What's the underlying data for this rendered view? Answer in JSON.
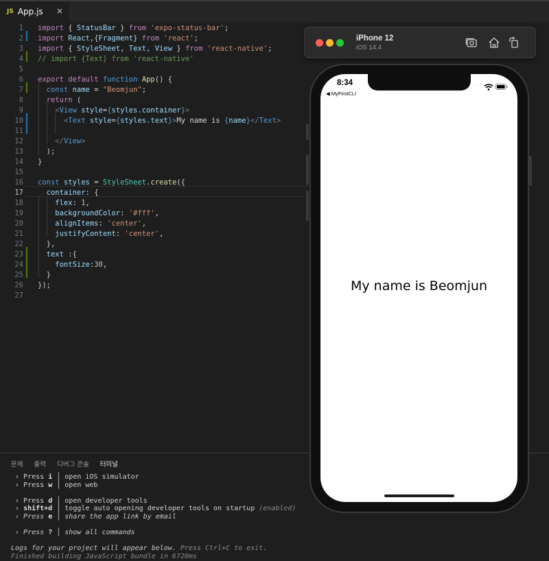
{
  "editor": {
    "tab": {
      "icon": "js-icon",
      "icon_label": "JS",
      "label": "App.js",
      "close": "×"
    },
    "lines": [
      [
        [
          "kw",
          "import"
        ],
        [
          "txt",
          " { "
        ],
        [
          "var",
          "StatusBar"
        ],
        [
          "txt",
          " } "
        ],
        [
          "kw",
          "from"
        ],
        [
          "str",
          " 'expo-status-bar'"
        ],
        [
          "txt",
          ";"
        ]
      ],
      [
        [
          "kw",
          "import"
        ],
        [
          "var",
          " React"
        ],
        [
          "txt",
          ",{"
        ],
        [
          "var",
          "Fragment"
        ],
        [
          "txt",
          "} "
        ],
        [
          "kw",
          "from"
        ],
        [
          "str",
          " 'react'"
        ],
        [
          "txt",
          ";"
        ]
      ],
      [
        [
          "kw",
          "import"
        ],
        [
          "txt",
          " { "
        ],
        [
          "var",
          "StyleSheet"
        ],
        [
          "txt",
          ", "
        ],
        [
          "var",
          "Text"
        ],
        [
          "txt",
          ", "
        ],
        [
          "var",
          "View"
        ],
        [
          "txt",
          " } "
        ],
        [
          "kw",
          "from"
        ],
        [
          "str",
          " 'react-native'"
        ],
        [
          "txt",
          ";"
        ]
      ],
      [
        [
          "cmt",
          "// import {Text} from 'react-native'"
        ]
      ],
      [],
      [
        [
          "kw",
          "export"
        ],
        [
          "kw",
          " default"
        ],
        [
          "b",
          " function"
        ],
        [
          "fn",
          " App"
        ],
        [
          "txt",
          "() {"
        ]
      ],
      [
        [
          "txt",
          "  "
        ],
        [
          "b",
          "const"
        ],
        [
          "var",
          " name"
        ],
        [
          "txt",
          " = "
        ],
        [
          "str",
          "\"Beomjun\""
        ],
        [
          "txt",
          ";"
        ]
      ],
      [
        [
          "txt",
          "  "
        ],
        [
          "kw",
          "return"
        ],
        [
          "txt",
          " ("
        ]
      ],
      [
        [
          "txt",
          "    "
        ],
        [
          "gray",
          "<"
        ],
        [
          "tag",
          "View"
        ],
        [
          "attr",
          " style"
        ],
        [
          "txt",
          "="
        ],
        [
          "b",
          "{"
        ],
        [
          "var",
          "styles"
        ],
        [
          "txt",
          "."
        ],
        [
          "var",
          "container"
        ],
        [
          "b",
          "}"
        ],
        [
          "gray",
          ">"
        ]
      ],
      [
        [
          "txt",
          "      "
        ],
        [
          "gray",
          "<"
        ],
        [
          "tag",
          "Text"
        ],
        [
          "attr",
          " style"
        ],
        [
          "txt",
          "="
        ],
        [
          "b",
          "{"
        ],
        [
          "var",
          "styles"
        ],
        [
          "txt",
          "."
        ],
        [
          "var",
          "text"
        ],
        [
          "b",
          "}"
        ],
        [
          "gray",
          ">"
        ],
        [
          "txt",
          "My name is "
        ],
        [
          "b",
          "{"
        ],
        [
          "var",
          "name"
        ],
        [
          "b",
          "}"
        ],
        [
          "gray",
          "</"
        ],
        [
          "tag",
          "Text"
        ],
        [
          "gray",
          ">"
        ]
      ],
      [],
      [
        [
          "txt",
          "    "
        ],
        [
          "gray",
          "</"
        ],
        [
          "tag",
          "View"
        ],
        [
          "gray",
          ">"
        ]
      ],
      [
        [
          "txt",
          "  );"
        ]
      ],
      [
        [
          "txt",
          "}"
        ]
      ],
      [],
      [
        [
          "b",
          "const"
        ],
        [
          "var",
          " styles"
        ],
        [
          "txt",
          " = "
        ],
        [
          "cls",
          "StyleSheet"
        ],
        [
          "txt",
          "."
        ],
        [
          "fn",
          "create"
        ],
        [
          "txt",
          "({"
        ]
      ],
      [
        [
          "var",
          "  container"
        ],
        [
          "txt",
          ": {"
        ]
      ],
      [
        [
          "var",
          "    flex"
        ],
        [
          "txt",
          ": "
        ],
        [
          "num",
          "1"
        ],
        [
          "txt",
          ","
        ]
      ],
      [
        [
          "var",
          "    backgroundColor"
        ],
        [
          "txt",
          ": "
        ],
        [
          "str",
          "'#fff'"
        ],
        [
          "txt",
          ","
        ]
      ],
      [
        [
          "var",
          "    alignItems"
        ],
        [
          "txt",
          ": "
        ],
        [
          "str",
          "'center'"
        ],
        [
          "txt",
          ","
        ]
      ],
      [
        [
          "var",
          "    justifyContent"
        ],
        [
          "txt",
          ": "
        ],
        [
          "str",
          "'center'"
        ],
        [
          "txt",
          ","
        ]
      ],
      [
        [
          "txt",
          "  },"
        ]
      ],
      [
        [
          "var",
          "  text"
        ],
        [
          "txt",
          " :{"
        ]
      ],
      [
        [
          "var",
          "    fontSize"
        ],
        [
          "txt",
          ":"
        ],
        [
          "num",
          "30"
        ],
        [
          "txt",
          ","
        ]
      ],
      [
        [
          "txt",
          "  }"
        ]
      ],
      [
        [
          "txt",
          "});"
        ]
      ],
      []
    ],
    "active_line": 17
  },
  "panel": {
    "tabs": [
      "문제",
      "출력",
      "디버그 콘솔",
      "터미널"
    ],
    "active_tab": 3,
    "terminal": [
      [
        [
          "txt",
          " › Press "
        ],
        [
          "k",
          "i"
        ],
        [
          "txt",
          " │ open iOS simulator"
        ]
      ],
      [
        [
          "txt",
          " › Press "
        ],
        [
          "k",
          "w"
        ],
        [
          "txt",
          " │ open web"
        ]
      ],
      [],
      [
        [
          "txt",
          " › Press "
        ],
        [
          "k",
          "d"
        ],
        [
          "txt",
          " │ open developer tools"
        ]
      ],
      [
        [
          "txt",
          " › "
        ],
        [
          "k",
          "shift+d"
        ],
        [
          "txt",
          " │ toggle auto opening developer tools on startup "
        ],
        [
          "dim",
          "(enabled)"
        ]
      ],
      [
        [
          "it",
          " › Press "
        ],
        [
          "k",
          "e"
        ],
        [
          "it",
          " │ share the app link by email"
        ]
      ],
      [],
      [
        [
          "it",
          " › Press "
        ],
        [
          "k",
          "?"
        ],
        [
          "it",
          " │ show all commands"
        ]
      ],
      [],
      [
        [
          "it",
          "Logs for your project will appear below. "
        ],
        [
          "dim",
          "Press Ctrl+C to exit."
        ]
      ],
      [
        [
          "dim",
          "Finished building JavaScript bundle in 6720ms"
        ]
      ]
    ]
  },
  "simulator": {
    "device": "iPhone 12",
    "os": "iOS 14.4",
    "toolbar_icons": [
      "screenshot-icon",
      "home-icon",
      "rotate-icon"
    ],
    "status_time": "8:34",
    "back_label": "◀ MyFirstCLI",
    "signal": "....",
    "app_text": "My name is Beomjun"
  },
  "colors": {
    "background": "#1e1e1e",
    "close_dot": "#fe5f57",
    "minimize_dot": "#febc2e",
    "zoom_dot": "#28c840",
    "git_modified": "#1f78b4",
    "git_added": "#587c0c"
  }
}
